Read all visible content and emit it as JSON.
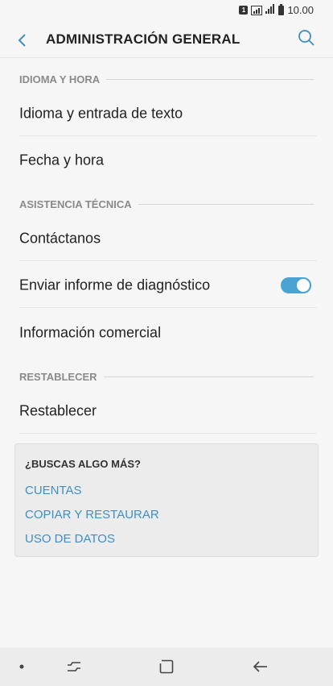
{
  "status": {
    "sim": "1",
    "time": "10.00"
  },
  "header": {
    "title": "ADMINISTRACIÓN GENERAL"
  },
  "sections": [
    {
      "label": "IDIOMA Y HORA"
    },
    {
      "label": "ASISTENCIA TÉCNICA"
    },
    {
      "label": "RESTABLECER"
    }
  ],
  "rows": [
    {
      "label": "Idioma y entrada de texto"
    },
    {
      "label": "Fecha y hora"
    },
    {
      "label": "Contáctanos"
    },
    {
      "label": "Enviar informe de diagnóstico",
      "toggle": true
    },
    {
      "label": "Información comercial"
    },
    {
      "label": "Restablecer"
    }
  ],
  "more": {
    "title": "¿BUSCAS ALGO MÁS?",
    "links": [
      "CUENTAS",
      "COPIAR Y RESTAURAR",
      "USO DE DATOS"
    ]
  },
  "colors": {
    "accent": "#4aa3d3",
    "link": "#3d8fc4"
  }
}
